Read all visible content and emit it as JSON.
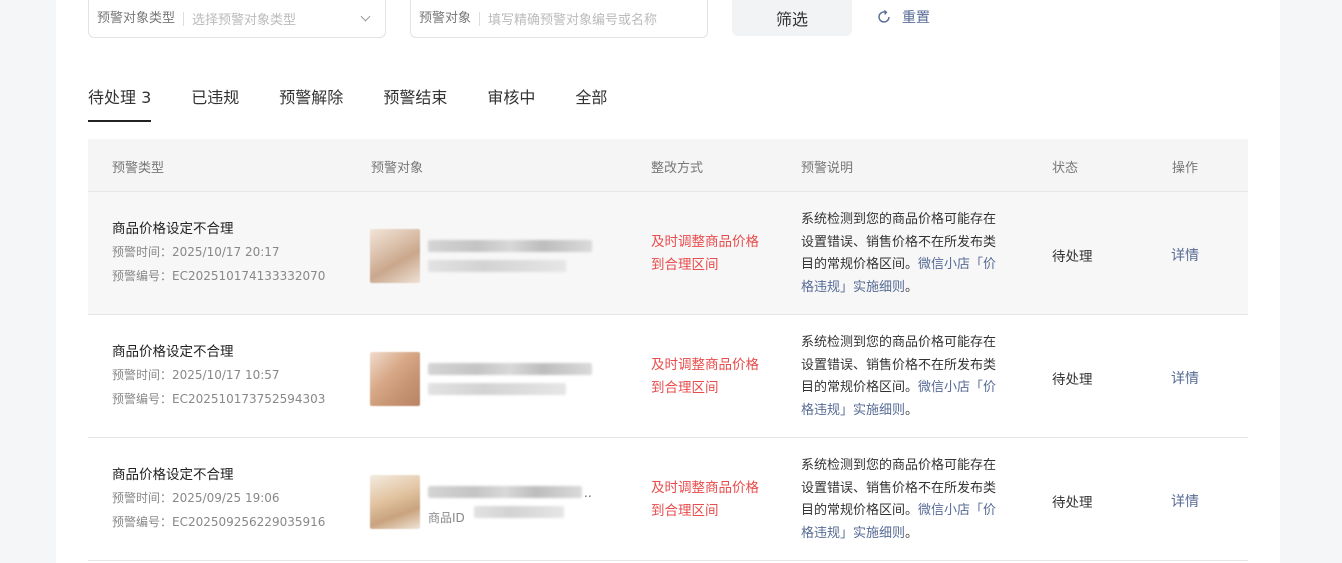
{
  "filters": {
    "warning_type": {
      "label": "预警对象类型",
      "placeholder": "选择预警对象类型"
    },
    "warning_object": {
      "label": "预警对象",
      "placeholder": "填写精确预警对象编号或名称"
    },
    "filter_button": "筛选",
    "reset_button": "重置"
  },
  "tabs": [
    {
      "label": "待处理 3",
      "active": true
    },
    {
      "label": "已违规"
    },
    {
      "label": "预警解除"
    },
    {
      "label": "预警结束"
    },
    {
      "label": "审核中"
    },
    {
      "label": "全部"
    }
  ],
  "table": {
    "columns": [
      "预警类型",
      "预警对象",
      "整改方式",
      "预警说明",
      "状态",
      "操作"
    ],
    "rows": [
      {
        "type": "商品价格设定不合理",
        "time": "预警时间：2025/10/17 20:17",
        "code": "预警编号：EC202510174133332070",
        "fix": "及时调整商品价格到合理区间",
        "desc": "系统检测到您的商品价格可能存在设置错误、销售价格不在所发布类目的常规价格区间。",
        "desc_link": "微信小店「价格违规」实施细则",
        "desc_end": "。",
        "status": "待处理",
        "action": "详情"
      },
      {
        "type": "商品价格设定不合理",
        "time": "预警时间：2025/10/17 10:57",
        "code": "预警编号：EC202510173752594303",
        "fix": "及时调整商品价格到合理区间",
        "desc": "系统检测到您的商品价格可能存在设置错误、销售价格不在所发布类目的常规价格区间。",
        "desc_link": "微信小店「价格违规」实施细则",
        "desc_end": "。",
        "status": "待处理",
        "action": "详情"
      },
      {
        "type": "商品价格设定不合理",
        "time": "预警时间：2025/09/25 19:06",
        "code": "预警编号：EC202509256229035916",
        "fix": "及时调整商品价格到合理区间",
        "desc": "系统检测到您的商品价格可能存在设置错误、销售价格不在所发布类目的常规价格区间。",
        "desc_link": "微信小店「价格违规」实施细则",
        "desc_end": "。",
        "status": "待处理",
        "action": "详情",
        "id_label": "商品ID",
        "ellipsis": ".."
      }
    ]
  },
  "colors": {
    "accent_link": "#576b95",
    "warning_red": "#e84c4c",
    "header_bg": "#f5f5f5"
  }
}
